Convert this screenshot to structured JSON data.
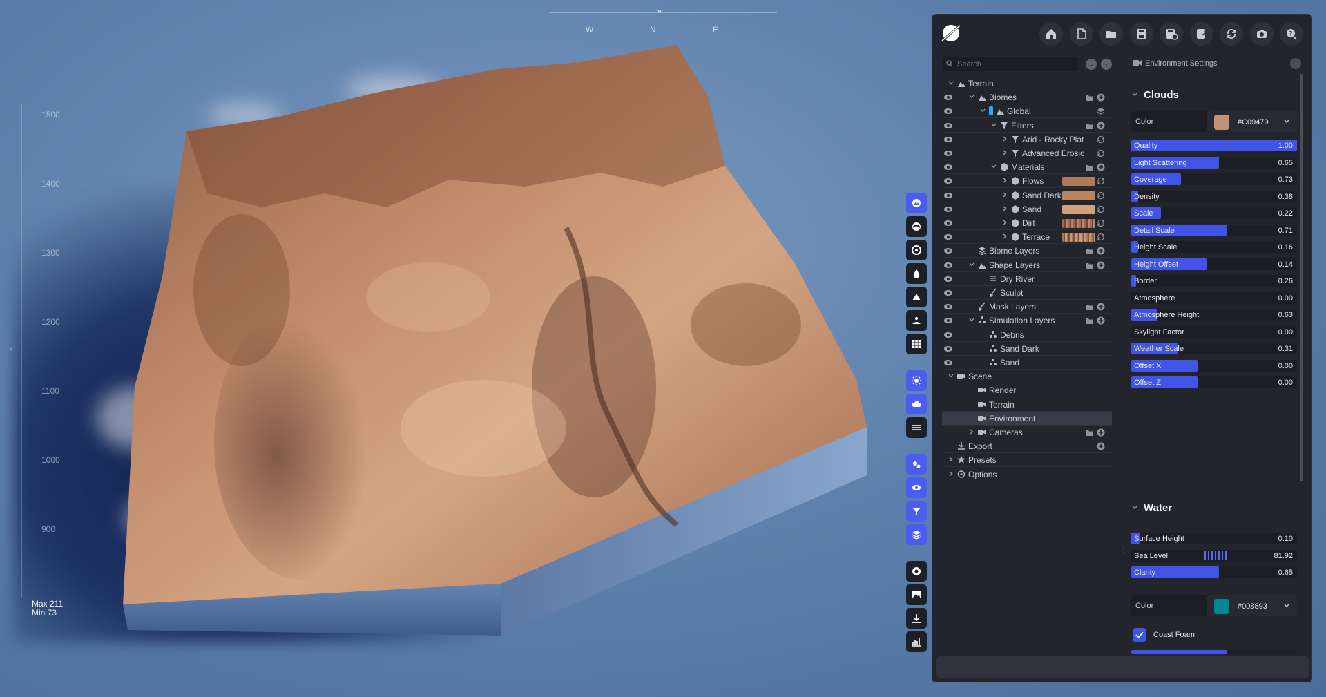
{
  "compass": {
    "w": "W",
    "n": "N",
    "e": "E"
  },
  "ruler": {
    "ticks": [
      "1500",
      "1400",
      "1300",
      "1200",
      "1100",
      "1000",
      "900"
    ],
    "max": "Max 211",
    "min": "Min 73"
  },
  "toolbar_icons": [
    "home-icon",
    "new-file-icon",
    "open-folder-icon",
    "save-icon",
    "save-as-icon",
    "export-icon",
    "refresh-icon",
    "camera-icon",
    "help-icon"
  ],
  "vertical_tools": [
    {
      "name": "terrain-tool",
      "active": true
    },
    {
      "name": "biome-tool",
      "active": false
    },
    {
      "name": "sculpt-tool",
      "active": false
    },
    {
      "name": "water-tool",
      "active": false
    },
    {
      "name": "mountain-tool",
      "active": false
    },
    {
      "name": "landscape-tool",
      "active": false
    },
    {
      "name": "grid-tool",
      "active": false
    },
    {
      "name": "sun-tool",
      "active": true
    },
    {
      "name": "clouds-tool",
      "active": true
    },
    {
      "name": "fog-tool",
      "active": false
    },
    {
      "name": "settings-tool",
      "active": true
    },
    {
      "name": "view-tool",
      "active": true
    },
    {
      "name": "filter-tool",
      "active": true
    },
    {
      "name": "layers-tool",
      "active": true
    },
    {
      "name": "record-tool",
      "active": false
    },
    {
      "name": "image-tool",
      "active": false
    },
    {
      "name": "download-tool",
      "active": false
    },
    {
      "name": "stats-tool",
      "active": false
    }
  ],
  "tree": {
    "search_placeholder": "Search",
    "rows": [
      {
        "label": "Terrain",
        "depth": 0,
        "eye": false,
        "chev": "down",
        "icon": "mountain",
        "actions": []
      },
      {
        "label": "Biomes",
        "depth": 1,
        "eye": true,
        "chev": "down",
        "icon": "mountain",
        "actions": [
          "folder",
          "add"
        ]
      },
      {
        "label": "Global",
        "depth": 2,
        "eye": true,
        "chev": "down",
        "icon": "mountain",
        "actions": [
          "layers"
        ],
        "tag": "#2ea8ff"
      },
      {
        "label": "Filters",
        "depth": 3,
        "eye": true,
        "chev": "down",
        "icon": "filter",
        "actions": [
          "folder",
          "add"
        ]
      },
      {
        "label": "Arid - Rocky Plateaus",
        "depth": 4,
        "eye": true,
        "chev": "right",
        "icon": "filter",
        "actions": [
          "refresh"
        ]
      },
      {
        "label": "Advanced Erosion - Scree",
        "depth": 4,
        "eye": true,
        "chev": "right",
        "icon": "filter",
        "actions": [
          "refresh"
        ]
      },
      {
        "label": "Materials",
        "depth": 3,
        "eye": true,
        "chev": "down",
        "icon": "cube",
        "actions": [
          "folder",
          "add"
        ]
      },
      {
        "label": "Flows",
        "depth": 4,
        "eye": true,
        "chev": "right",
        "icon": "cube",
        "actions": [
          "refresh"
        ],
        "swatch": "#b07a58"
      },
      {
        "label": "Sand Dark",
        "depth": 4,
        "eye": true,
        "chev": "right",
        "icon": "cube",
        "actions": [
          "refresh"
        ],
        "swatch": "#b98560"
      },
      {
        "label": "Sand",
        "depth": 4,
        "eye": true,
        "chev": "right",
        "icon": "cube",
        "actions": [
          "refresh"
        ],
        "swatch": "#d0a07c"
      },
      {
        "label": "Dirt",
        "depth": 4,
        "eye": true,
        "chev": "right",
        "icon": "cube",
        "actions": [
          "refresh"
        ],
        "swatch": "stripe1"
      },
      {
        "label": "Terrace",
        "depth": 4,
        "eye": true,
        "chev": "right",
        "icon": "cube",
        "actions": [
          "refresh"
        ],
        "swatch": "stripe2"
      },
      {
        "label": "Biome Layers",
        "depth": 1,
        "eye": true,
        "chev": "none",
        "icon": "layers",
        "actions": [
          "folder",
          "add"
        ]
      },
      {
        "label": "Shape Layers",
        "depth": 1,
        "eye": true,
        "chev": "down",
        "icon": "mountain",
        "actions": [
          "folder",
          "add"
        ]
      },
      {
        "label": "Dry River",
        "depth": 2,
        "eye": true,
        "chev": "none",
        "icon": "lines",
        "actions": []
      },
      {
        "label": "Sculpt",
        "depth": 2,
        "eye": true,
        "chev": "none",
        "icon": "brush",
        "actions": []
      },
      {
        "label": "Mask Layers",
        "depth": 1,
        "eye": true,
        "chev": "none",
        "icon": "brush",
        "actions": [
          "folder",
          "add"
        ]
      },
      {
        "label": "Simulation Layers",
        "depth": 1,
        "eye": true,
        "chev": "down",
        "icon": "sim",
        "actions": [
          "folder",
          "add"
        ]
      },
      {
        "label": "Debris",
        "depth": 2,
        "eye": true,
        "chev": "none",
        "icon": "sim",
        "actions": []
      },
      {
        "label": "Sand Dark",
        "depth": 2,
        "eye": true,
        "chev": "none",
        "icon": "sim",
        "actions": []
      },
      {
        "label": "Sand",
        "depth": 2,
        "eye": true,
        "chev": "none",
        "icon": "sim",
        "actions": []
      },
      {
        "label": "Scene",
        "depth": 0,
        "eye": false,
        "chev": "down",
        "icon": "camera",
        "actions": []
      },
      {
        "label": "Render",
        "depth": 1,
        "eye": false,
        "chev": "none",
        "icon": "camera",
        "actions": []
      },
      {
        "label": "Terrain",
        "depth": 1,
        "eye": false,
        "chev": "none",
        "icon": "camera",
        "actions": []
      },
      {
        "label": "Environment",
        "depth": 1,
        "eye": false,
        "chev": "none",
        "icon": "camera",
        "actions": [],
        "selected": true
      },
      {
        "label": "Cameras",
        "depth": 1,
        "eye": false,
        "chev": "right",
        "icon": "camera",
        "actions": [
          "folder",
          "add"
        ]
      },
      {
        "label": "Export",
        "depth": 0,
        "eye": false,
        "chev": "none",
        "icon": "export",
        "actions": [
          "add"
        ]
      },
      {
        "label": "Presets",
        "depth": 0,
        "eye": false,
        "chev": "right",
        "icon": "star",
        "actions": []
      },
      {
        "label": "Options",
        "depth": 0,
        "eye": false,
        "chev": "right",
        "icon": "gear",
        "actions": []
      }
    ]
  },
  "settings": {
    "header": "Environment Settings",
    "clouds": {
      "title": "Clouds",
      "color_label": "Color",
      "color_hex": "#C09479",
      "color": "#c09479",
      "sliders": [
        {
          "label": "Quality",
          "value": "1.00",
          "fill": 1.0
        },
        {
          "label": "Light Scattering",
          "value": "0.65",
          "fill": 0.53
        },
        {
          "label": "Coverage",
          "value": "0.73",
          "fill": 0.3
        },
        {
          "label": "Density",
          "value": "0.38",
          "fill": 0.04
        },
        {
          "label": "Scale",
          "value": "0.22",
          "fill": 0.18
        },
        {
          "label": "Detail Scale",
          "value": "0.71",
          "fill": 0.58
        },
        {
          "label": "Height Scale",
          "value": "0.16",
          "fill": 0.04
        },
        {
          "label": "Height Offset",
          "value": "0.14",
          "fill": 0.46
        },
        {
          "label": "Border",
          "value": "0.26",
          "fill": 0.03
        },
        {
          "label": "Atmosphere",
          "value": "0.00",
          "fill": 0.0
        },
        {
          "label": "Atmosphere Height",
          "value": "0.63",
          "fill": 0.16
        },
        {
          "label": "Skylight Factor",
          "value": "0.00",
          "fill": 0.0
        },
        {
          "label": "Weather Scale",
          "value": "0.31",
          "fill": 0.28
        },
        {
          "label": "Offset X",
          "value": "0.00",
          "fill": 0.4
        },
        {
          "label": "Offset Z",
          "value": "0.00",
          "fill": 0.4
        }
      ]
    },
    "water": {
      "title": "Water",
      "sliders": [
        {
          "label": "Surface Height",
          "value": "0.10",
          "fill": 0.05
        },
        {
          "label": "Sea Level",
          "value": "81.92",
          "fill": 0.0,
          "ticks": true
        },
        {
          "label": "Clarity",
          "value": "0.65",
          "fill": 0.53
        }
      ],
      "color_label": "Color",
      "color_hex": "#008893",
      "color": "#008893",
      "coast_foam": "Coast Foam"
    }
  }
}
